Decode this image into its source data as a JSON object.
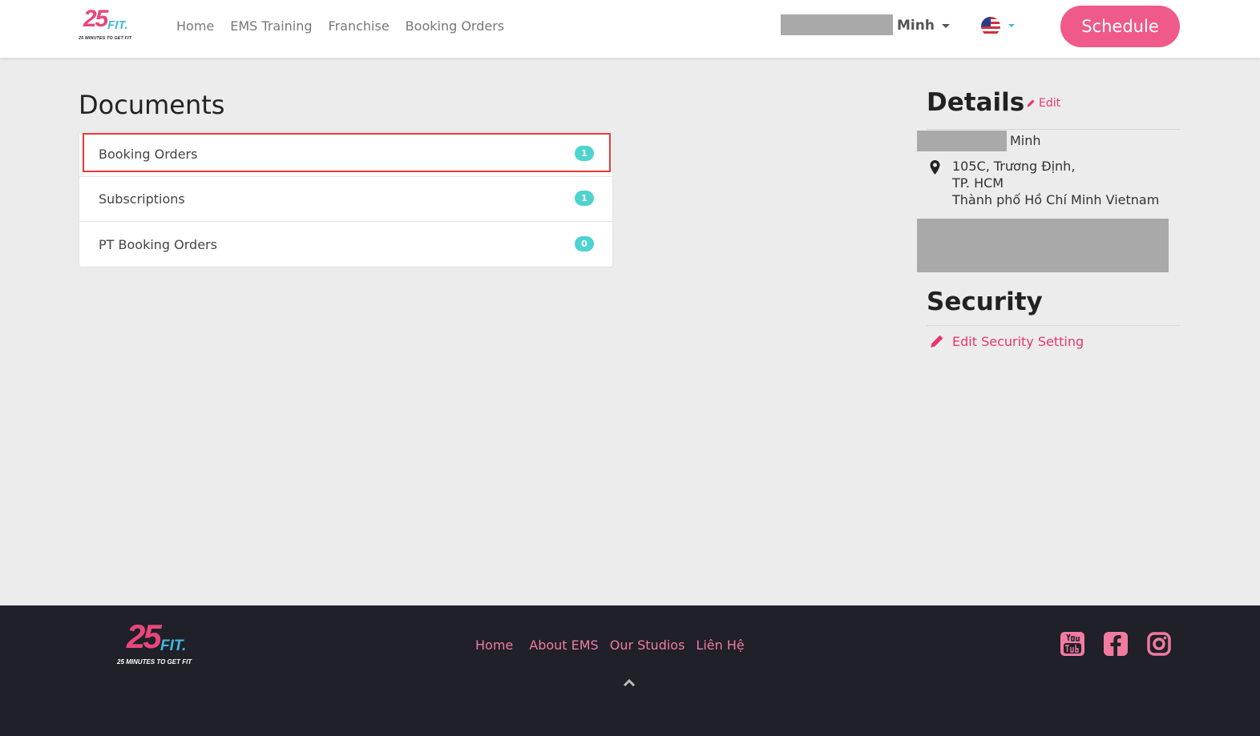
{
  "header": {
    "logo": {
      "main": "25",
      "accent": "FIT.",
      "tagline": "25 MINUTES TO GET FIT"
    },
    "nav": [
      "Home",
      "EMS Training",
      "Franchise",
      "Booking Orders"
    ],
    "user_name": "Minh",
    "schedule_label": "Schedule"
  },
  "documents": {
    "title": "Documents",
    "items": [
      {
        "label": "Booking Orders",
        "count": "1"
      },
      {
        "label": "Subscriptions",
        "count": "1"
      },
      {
        "label": "PT Booking Orders",
        "count": "0"
      }
    ]
  },
  "details": {
    "title": "Details",
    "edit_label": "Edit",
    "name": "Minh",
    "address": {
      "line1": "105C, Trương Định,",
      "line2": "TP. HCM",
      "line3": "Thành phố Hồ Chí Minh Vietnam"
    }
  },
  "security": {
    "title": "Security",
    "edit_label": "Edit Security Setting"
  },
  "footer": {
    "logo": {
      "main": "25",
      "accent": "FIT.",
      "tagline": "25 MINUTES TO GET FIT"
    },
    "links": [
      "Home",
      "About EMS",
      "Our Studios",
      "Liên Hệ"
    ]
  },
  "colors": {
    "accent_pink": "#ef5a8b",
    "link_pink": "#e8366f",
    "badge_teal": "#4ed3cf",
    "footer_bg": "#1f2028",
    "highlight_red": "#e53935"
  },
  "icons": [
    "user-caret-icon",
    "us-flag-icon",
    "pencil-icon",
    "map-pin-icon",
    "chevron-up-icon",
    "youtube-icon",
    "facebook-icon",
    "instagram-icon"
  ]
}
